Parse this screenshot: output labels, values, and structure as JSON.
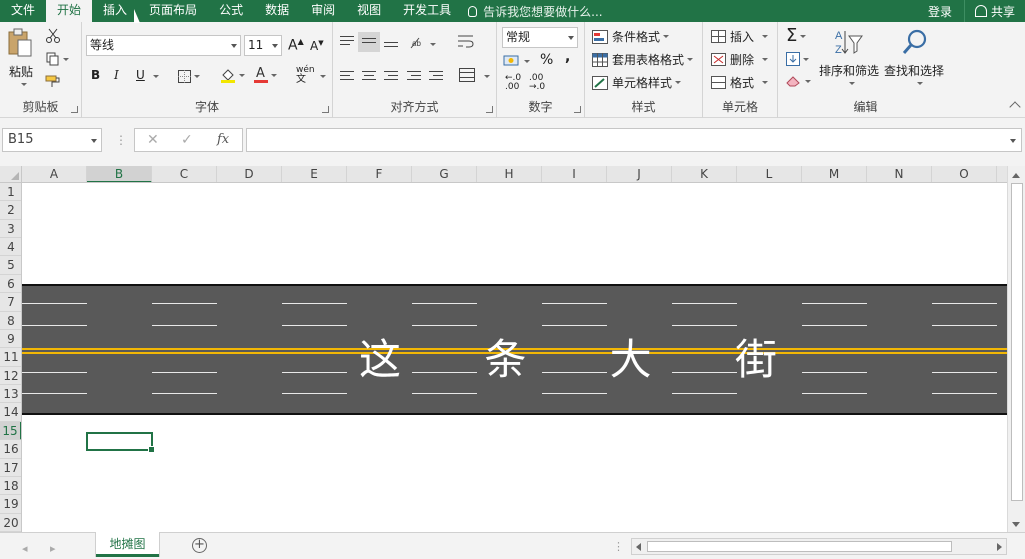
{
  "tabs": [
    "文件",
    "开始",
    "插入",
    "页面布局",
    "公式",
    "数据",
    "审阅",
    "视图",
    "开发工具"
  ],
  "active_tab": "开始",
  "tell_me": "告诉我您想要做什么...",
  "login": "登录",
  "share": "共享",
  "clipboard": {
    "label": "剪贴板",
    "paste": "粘贴"
  },
  "font": {
    "label": "字体",
    "name": "等线",
    "size": "11",
    "bold": "B",
    "italic": "I",
    "underline": "U",
    "grow": "A",
    "shrink": "A",
    "phonetic": "wén",
    "font_color_glyph": "A"
  },
  "alignment": {
    "label": "对齐方式"
  },
  "number": {
    "label": "数字",
    "format": "常规",
    "percent": "%",
    "comma": ",",
    "inc_dec": ".00",
    "dec_dec": ".0"
  },
  "styles": {
    "label": "样式",
    "conditional": "条件格式",
    "table": "套用表格格式",
    "cell_styles": "单元格样式"
  },
  "cells": {
    "label": "单元格",
    "insert": "插入",
    "delete": "删除",
    "format": "格式"
  },
  "editing": {
    "label": "编辑",
    "sort_filter": "排序和筛选",
    "find_select": "查找和选择"
  },
  "name_box": "B15",
  "formula_bar": {
    "cancel": "✕",
    "enter": "✓",
    "fx": "fx",
    "value": ""
  },
  "columns": [
    "A",
    "B",
    "C",
    "D",
    "E",
    "F",
    "G",
    "H",
    "I",
    "J",
    "K",
    "L",
    "M",
    "N",
    "O"
  ],
  "selected_column": "B",
  "rows": [
    "1",
    "2",
    "3",
    "4",
    "5",
    "6",
    "7",
    "8",
    "9",
    "11",
    "12",
    "13",
    "14",
    "15",
    "16",
    "17",
    "18",
    "19",
    "20"
  ],
  "selected_row": "15",
  "road_title": [
    "这",
    "条",
    "大",
    "街"
  ],
  "sheet_tab": "地摊图",
  "colors": {
    "accent": "#217346",
    "road": "#595959",
    "center_line": "#f2b705"
  }
}
